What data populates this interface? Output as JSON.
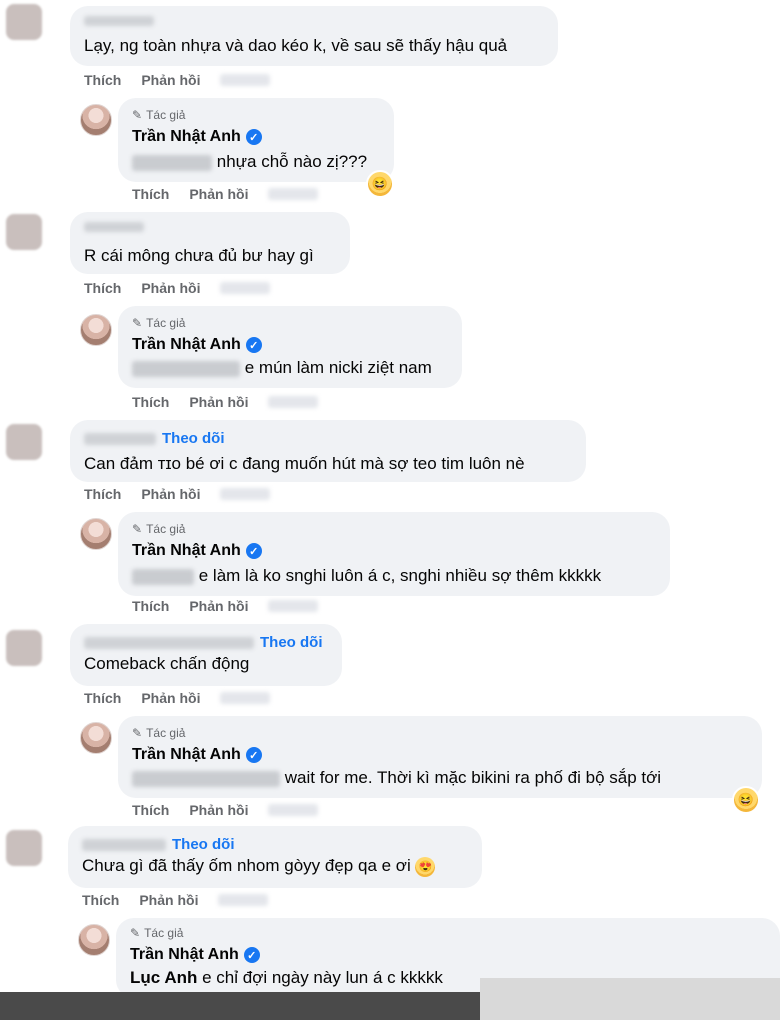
{
  "labels": {
    "like": "Thích",
    "reply": "Phản hồi",
    "author_badge": "Tác giả",
    "follow": "Theo dõi",
    "author_name": "Trần Nhật Anh"
  },
  "comments": [
    {
      "text": "Lạy, ng toàn nhựa và dao kéo k, về sau sẽ thấy hậu quả"
    },
    {
      "text": "nhựa chỗ nào zị???",
      "reaction": "😆"
    },
    {
      "text": "R cái mông chưa đủ bư hay gì"
    },
    {
      "text": "e mún làm nicki ziệt nam"
    },
    {
      "text": "Can đảm ᴛɪᴏ bé ơi c đang muốn hút mà sợ teo tim luôn nè"
    },
    {
      "text": "e làm là ko snghi luôn á c, snghi nhiều sợ thêm kkkkk"
    },
    {
      "text": "Comeback chấn động"
    },
    {
      "text": "wait for me. Thời kì mặc bikini ra phố đi bộ sắp tới",
      "reaction": "😆"
    },
    {
      "text": "Chưa gì đã thấy ốm nhom gòyy đẹp qa e ơi"
    },
    {
      "mention": "Lục Anh",
      "text": "e chỉ đợi ngày này lun á c kkkkk"
    }
  ]
}
